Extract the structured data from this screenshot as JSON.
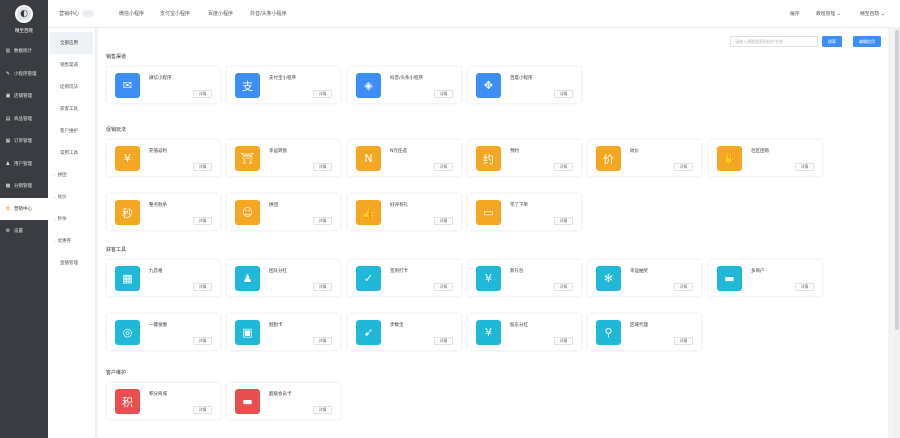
{
  "brand": {
    "name": "精至百晓",
    "logo_icon": "store-logo-icon"
  },
  "sidebar": {
    "items": [
      {
        "label": "数据统计",
        "icon": "▥",
        "active": false
      },
      {
        "label": "小程序管理",
        "icon": "✎",
        "active": false
      },
      {
        "label": "店铺管理",
        "icon": "▣",
        "active": false
      },
      {
        "label": "商品管理",
        "icon": "▤",
        "active": false
      },
      {
        "label": "订单管理",
        "icon": "▦",
        "active": false
      },
      {
        "label": "用户管理",
        "icon": "♟",
        "active": false
      },
      {
        "label": "分销管理",
        "icon": "▩",
        "active": false
      },
      {
        "label": "营销中心",
        "icon": "✿",
        "active": true
      },
      {
        "label": "设置",
        "icon": "⚙",
        "active": false
      }
    ]
  },
  "topbar": {
    "first": "营销中心",
    "toggle": "◦◦◦",
    "links": [
      "微信小程序",
      "支付宝小程序",
      "百度小程序",
      "抖音/头条小程序"
    ],
    "right": [
      "缓存",
      "教程管理",
      "精至百晓"
    ]
  },
  "subnav": {
    "items": [
      {
        "label": "全部应用",
        "active": true,
        "group": false
      },
      {
        "label": "销售渠道",
        "active": false,
        "group": false
      },
      {
        "label": "促销玩法",
        "active": false,
        "group": false
      },
      {
        "label": "获客工具",
        "active": false,
        "group": false
      },
      {
        "label": "客户维护",
        "active": false,
        "group": false
      },
      {
        "label": "常用工具",
        "active": false,
        "group": false
      },
      {
        "label": "拼团",
        "active": false,
        "group": true
      },
      {
        "label": "砍价",
        "active": false,
        "group": true
      },
      {
        "label": "秒杀",
        "active": false,
        "group": true
      },
      {
        "label": "优惠券",
        "active": false,
        "group": true
      },
      {
        "label": "直播管理",
        "active": false,
        "group": false
      }
    ]
  },
  "search": {
    "placeholder": "请输入想要搜索的插件名称",
    "button": "搜索",
    "manage_button": "编辑应用"
  },
  "detail_label": "详情",
  "sections": [
    {
      "title": "销售渠道",
      "cards": [
        {
          "title": "微信小程序",
          "color": "#3d8ef8",
          "icon": "wechat-icon",
          "glyph": "✉"
        },
        {
          "title": "支付宝小程序",
          "color": "#3d8ef8",
          "icon": "alipay-icon",
          "glyph": "支"
        },
        {
          "title": "抖音/头条小程序",
          "color": "#3d8ef8",
          "icon": "douyin-icon",
          "glyph": "◈"
        },
        {
          "title": "百度小程序",
          "color": "#3d8ef8",
          "icon": "baidu-icon",
          "glyph": "✥"
        }
      ]
    },
    {
      "title": "促销玩法",
      "cards": [
        {
          "title": "充值返利",
          "color": "#f5a623",
          "icon": "recharge-icon",
          "glyph": "¥"
        },
        {
          "title": "幸运转盘",
          "color": "#f5a623",
          "icon": "lucky-wheel-icon",
          "glyph": "⛩"
        },
        {
          "title": "N元任选",
          "color": "#f5a623",
          "icon": "n-yuan-icon",
          "glyph": "N"
        },
        {
          "title": "预约",
          "color": "#f5a623",
          "icon": "booking-icon",
          "glyph": "约"
        },
        {
          "title": "砍价",
          "color": "#f5a623",
          "icon": "bargain-icon",
          "glyph": "价"
        },
        {
          "title": "社区团购",
          "color": "#f5a623",
          "icon": "group-buy-icon",
          "glyph": "✋"
        },
        {
          "title": "整点秒杀",
          "color": "#f5a623",
          "icon": "flash-sale-icon",
          "glyph": "秒"
        },
        {
          "title": "拼团",
          "color": "#f5a623",
          "icon": "team-buy-icon",
          "glyph": "☺"
        },
        {
          "title": "好评有礼",
          "color": "#f5a623",
          "icon": "review-reward-icon",
          "glyph": "👍"
        },
        {
          "title": "宅了下单",
          "color": "#f5a623",
          "icon": "wallet-icon",
          "glyph": "▭"
        }
      ]
    },
    {
      "title": "获客工具",
      "cards": [
        {
          "title": "九宫格",
          "color": "#1fb8d8",
          "icon": "grid-icon",
          "glyph": "▦"
        },
        {
          "title": "团队分红",
          "color": "#1fb8d8",
          "icon": "team-bonus-icon",
          "glyph": "♟"
        },
        {
          "title": "签到打卡",
          "color": "#1fb8d8",
          "icon": "checkin-icon",
          "glyph": "✓"
        },
        {
          "title": "新礼包",
          "color": "#1fb8d8",
          "icon": "gift-pack-icon",
          "glyph": "¥"
        },
        {
          "title": "幸运抽奖",
          "color": "#1fb8d8",
          "icon": "lottery-icon",
          "glyph": "✻"
        },
        {
          "title": "多商户",
          "color": "#1fb8d8",
          "icon": "multi-store-icon",
          "glyph": "▬"
        },
        {
          "title": "一键发圈",
          "color": "#1fb8d8",
          "icon": "camera-icon",
          "glyph": "◎"
        },
        {
          "title": "刮刮卡",
          "color": "#1fb8d8",
          "icon": "scratch-card-icon",
          "glyph": "▣"
        },
        {
          "title": "步数宝",
          "color": "#1fb8d8",
          "icon": "step-icon",
          "glyph": "➹"
        },
        {
          "title": "股东分红",
          "color": "#1fb8d8",
          "icon": "shareholder-icon",
          "glyph": "¥"
        },
        {
          "title": "区域代理",
          "color": "#1fb8d8",
          "icon": "region-agent-icon",
          "glyph": "⚲"
        }
      ]
    },
    {
      "title": "客户维护",
      "cards": [
        {
          "title": "积分商城",
          "color": "#e8504f",
          "icon": "points-mall-icon",
          "glyph": "积"
        },
        {
          "title": "超级会员卡",
          "color": "#e8504f",
          "icon": "vip-card-icon",
          "glyph": "▬"
        }
      ]
    }
  ]
}
